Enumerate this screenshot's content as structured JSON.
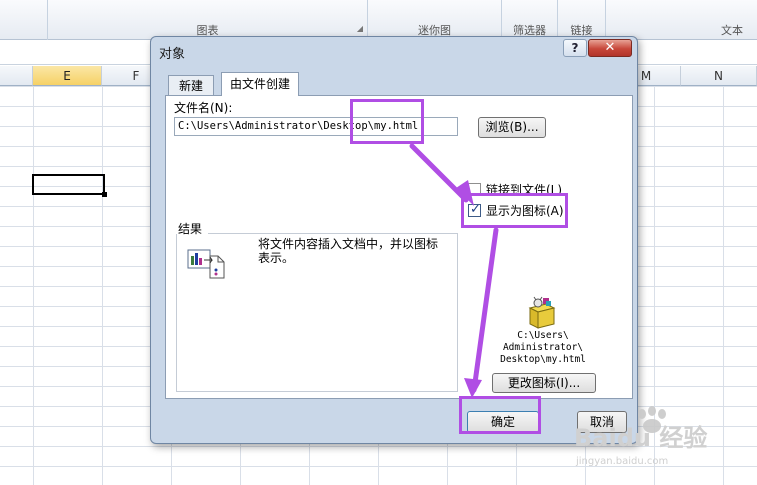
{
  "ribbon": {
    "groups": [
      "图表",
      "迷你图",
      "筛选器",
      "链接",
      "文本"
    ]
  },
  "sheet": {
    "columns": [
      "E",
      "F",
      "M",
      "N"
    ],
    "selected_column": "E"
  },
  "dialog": {
    "title": "对象",
    "help_label": "?",
    "close_label": "✕",
    "tabs": [
      "新建",
      "由文件创建"
    ],
    "active_tab": "由文件创建",
    "filename_label": "文件名(N):",
    "filename_value": "C:\\Users\\Administrator\\Desktop\\my.html",
    "browse_label": "浏览(B)...",
    "link_label": "链接到文件(L)",
    "link_checked": false,
    "display_as_icon_label": "显示为图标(A)",
    "display_as_icon_checked": true,
    "result_label": "结果",
    "result_text_line1": "将文件内容插入文档中，并以图标",
    "result_text_line2": "表示。",
    "icon_caption": [
      "C:\\Users\\",
      "Administrator\\",
      "Desktop\\my.html"
    ],
    "change_icon_label": "更改图标(I)...",
    "ok_label": "确定",
    "cancel_label": "取消"
  },
  "watermark": {
    "brand": "Baidu 经验",
    "url": "jingyan.baidu.com"
  },
  "colors": {
    "annotation": "#b04ee4",
    "dialog_bg": "#c9d7e8",
    "close_button": "#c7473a"
  }
}
